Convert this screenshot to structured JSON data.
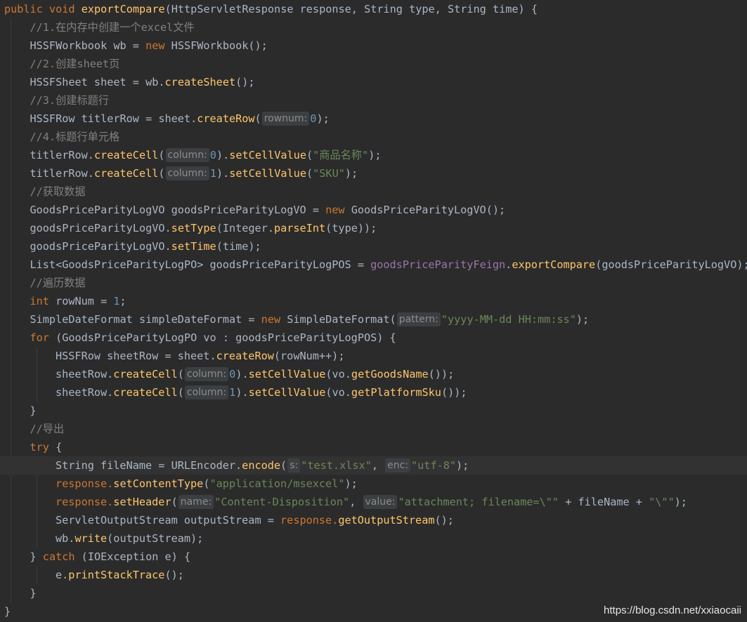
{
  "editor": {
    "theme": {
      "background": "#2b2b2b",
      "current_line": "#323232",
      "default_text": "#a9b7c6",
      "keyword": "#cc7832",
      "method": "#ffc66d",
      "type": "#a9b7c6",
      "comment": "#808080",
      "string": "#6a8759",
      "number": "#6897bb",
      "field": "#9876aa",
      "hint_bg": "#3b3f41",
      "hint_text": "#8c8c8c"
    },
    "lines": [
      {
        "indent": 0,
        "tokens": [
          {
            "t": "public void ",
            "c": "kw"
          },
          {
            "t": "exportCompare",
            "c": "meth"
          },
          {
            "t": "(HttpServletResponse ",
            "c": "def"
          },
          {
            "t": "response",
            "c": "def"
          },
          {
            "t": ", String ",
            "c": "def"
          },
          {
            "t": "type",
            "c": "def"
          },
          {
            "t": ", String ",
            "c": "def"
          },
          {
            "t": "time",
            "c": "def"
          },
          {
            "t": ") {",
            "c": "def"
          }
        ]
      },
      {
        "indent": 1,
        "tokens": [
          {
            "t": "//1.在内存中创建一个excel文件",
            "c": "cmt"
          }
        ]
      },
      {
        "indent": 1,
        "tokens": [
          {
            "t": "HSSFWorkbook wb = ",
            "c": "def"
          },
          {
            "t": "new ",
            "c": "kw"
          },
          {
            "t": "HSSFWorkbook();",
            "c": "def"
          }
        ]
      },
      {
        "indent": 1,
        "tokens": [
          {
            "t": "//2.创建sheet页",
            "c": "cmt"
          }
        ]
      },
      {
        "indent": 1,
        "tokens": [
          {
            "t": "HSSFSheet sheet = wb.",
            "c": "def"
          },
          {
            "t": "createSheet",
            "c": "meth"
          },
          {
            "t": "();",
            "c": "def"
          }
        ]
      },
      {
        "indent": 1,
        "tokens": [
          {
            "t": "//3.创建标题行",
            "c": "cmt"
          }
        ]
      },
      {
        "indent": 1,
        "tokens": [
          {
            "t": "HSSFRow titlerRow = sheet.",
            "c": "def"
          },
          {
            "t": "createRow",
            "c": "meth"
          },
          {
            "t": "(",
            "c": "def"
          },
          {
            "h": "rownum:"
          },
          {
            "t": "0",
            "c": "num"
          },
          {
            "t": ");",
            "c": "def"
          }
        ]
      },
      {
        "indent": 1,
        "tokens": [
          {
            "t": "//4.标题行单元格",
            "c": "cmt"
          }
        ]
      },
      {
        "indent": 1,
        "tokens": [
          {
            "t": "titlerRow.",
            "c": "def"
          },
          {
            "t": "createCell",
            "c": "meth"
          },
          {
            "t": "(",
            "c": "def"
          },
          {
            "h": "column:"
          },
          {
            "t": "0",
            "c": "num"
          },
          {
            "t": ").",
            "c": "def"
          },
          {
            "t": "setCellValue",
            "c": "meth"
          },
          {
            "t": "(",
            "c": "def"
          },
          {
            "t": "\"商品名称\"",
            "c": "str"
          },
          {
            "t": ");",
            "c": "def"
          }
        ]
      },
      {
        "indent": 1,
        "tokens": [
          {
            "t": "titlerRow.",
            "c": "def"
          },
          {
            "t": "createCell",
            "c": "meth"
          },
          {
            "t": "(",
            "c": "def"
          },
          {
            "h": "column:"
          },
          {
            "t": "1",
            "c": "num"
          },
          {
            "t": ").",
            "c": "def"
          },
          {
            "t": "setCellValue",
            "c": "meth"
          },
          {
            "t": "(",
            "c": "def"
          },
          {
            "t": "\"SKU\"",
            "c": "str"
          },
          {
            "t": ");",
            "c": "def"
          }
        ]
      },
      {
        "indent": 1,
        "tokens": [
          {
            "t": "//获取数据",
            "c": "cmt"
          }
        ]
      },
      {
        "indent": 1,
        "tokens": [
          {
            "t": "GoodsPriceParityLogVO goodsPriceParityLogVO = ",
            "c": "def"
          },
          {
            "t": "new ",
            "c": "kw"
          },
          {
            "t": "GoodsPriceParityLogVO();",
            "c": "def"
          }
        ]
      },
      {
        "indent": 1,
        "tokens": [
          {
            "t": "goodsPriceParityLogVO.",
            "c": "def"
          },
          {
            "t": "setType",
            "c": "meth"
          },
          {
            "t": "(Integer.",
            "c": "def"
          },
          {
            "t": "parseInt",
            "c": "meth"
          },
          {
            "t": "(type));",
            "c": "def"
          }
        ]
      },
      {
        "indent": 1,
        "tokens": [
          {
            "t": "goodsPriceParityLogVO.",
            "c": "def"
          },
          {
            "t": "setTime",
            "c": "meth"
          },
          {
            "t": "(time);",
            "c": "def"
          }
        ]
      },
      {
        "indent": 1,
        "tokens": [
          {
            "t": "List<GoodsPriceParityLogPO> goodsPriceParityLogPOS = ",
            "c": "def"
          },
          {
            "t": "goodsPriceParityFeign",
            "c": "fld"
          },
          {
            "t": ".",
            "c": "def"
          },
          {
            "t": "exportCompare",
            "c": "meth"
          },
          {
            "t": "(goodsPriceParityLogVO);",
            "c": "def"
          }
        ]
      },
      {
        "indent": 1,
        "tokens": [
          {
            "t": "//遍历数据",
            "c": "cmt"
          }
        ]
      },
      {
        "indent": 1,
        "tokens": [
          {
            "t": "int ",
            "c": "kw"
          },
          {
            "t": "rowNum = ",
            "c": "def"
          },
          {
            "t": "1",
            "c": "num"
          },
          {
            "t": ";",
            "c": "def"
          }
        ]
      },
      {
        "indent": 1,
        "tokens": [
          {
            "t": "SimpleDateFormat simpleDateFormat = ",
            "c": "def"
          },
          {
            "t": "new ",
            "c": "kw"
          },
          {
            "t": "SimpleDateFormat(",
            "c": "def"
          },
          {
            "h": "pattern:"
          },
          {
            "t": "\"yyyy-MM-dd HH:mm:ss\"",
            "c": "str"
          },
          {
            "t": ");",
            "c": "def"
          }
        ]
      },
      {
        "indent": 1,
        "tokens": [
          {
            "t": "for ",
            "c": "kw"
          },
          {
            "t": "(GoodsPriceParityLogPO vo : goodsPriceParityLogPOS) {",
            "c": "def"
          }
        ]
      },
      {
        "indent": 2,
        "tokens": [
          {
            "t": "HSSFRow sheetRow = sheet.",
            "c": "def"
          },
          {
            "t": "createRow",
            "c": "meth"
          },
          {
            "t": "(rowNum++);",
            "c": "def"
          }
        ]
      },
      {
        "indent": 2,
        "tokens": [
          {
            "t": "sheetRow.",
            "c": "def"
          },
          {
            "t": "createCell",
            "c": "meth"
          },
          {
            "t": "(",
            "c": "def"
          },
          {
            "h": "column:"
          },
          {
            "t": "0",
            "c": "num"
          },
          {
            "t": ").",
            "c": "def"
          },
          {
            "t": "setCellValue",
            "c": "meth"
          },
          {
            "t": "(vo.",
            "c": "def"
          },
          {
            "t": "getGoodsName",
            "c": "meth"
          },
          {
            "t": "());",
            "c": "def"
          }
        ]
      },
      {
        "indent": 2,
        "tokens": [
          {
            "t": "sheetRow.",
            "c": "def"
          },
          {
            "t": "createCell",
            "c": "meth"
          },
          {
            "t": "(",
            "c": "def"
          },
          {
            "h": "column:"
          },
          {
            "t": "1",
            "c": "num"
          },
          {
            "t": ").",
            "c": "def"
          },
          {
            "t": "setCellValue",
            "c": "meth"
          },
          {
            "t": "(vo.",
            "c": "def"
          },
          {
            "t": "getPlatformSku",
            "c": "meth"
          },
          {
            "t": "());",
            "c": "def"
          }
        ]
      },
      {
        "indent": 1,
        "tokens": [
          {
            "t": "}",
            "c": "def"
          }
        ]
      },
      {
        "indent": 1,
        "tokens": [
          {
            "t": "//导出",
            "c": "cmt"
          }
        ]
      },
      {
        "indent": 1,
        "tokens": [
          {
            "t": "try ",
            "c": "kw"
          },
          {
            "t": "{",
            "c": "def"
          }
        ]
      },
      {
        "indent": 2,
        "current": true,
        "tokens": [
          {
            "t": "String fileName = URLEncoder.",
            "c": "def"
          },
          {
            "t": "encode",
            "c": "meth"
          },
          {
            "t": "(",
            "c": "def"
          },
          {
            "h": "s:"
          },
          {
            "t": "\"test.xlsx\"",
            "c": "str"
          },
          {
            "t": ", ",
            "c": "def"
          },
          {
            "h": "enc:"
          },
          {
            "t": "\"utf-8\"",
            "c": "str"
          },
          {
            "t": ");",
            "c": "def"
          }
        ]
      },
      {
        "indent": 2,
        "tokens": [
          {
            "t": "response.",
            "c": "kw"
          },
          {
            "t": "setContentType",
            "c": "meth"
          },
          {
            "t": "(",
            "c": "def"
          },
          {
            "t": "\"application/msexcel\"",
            "c": "str"
          },
          {
            "t": ");",
            "c": "def"
          }
        ]
      },
      {
        "indent": 2,
        "tokens": [
          {
            "t": "response.",
            "c": "kw"
          },
          {
            "t": "setHeader",
            "c": "meth"
          },
          {
            "t": "(",
            "c": "def"
          },
          {
            "h": "name:"
          },
          {
            "t": "\"Content-Disposition\"",
            "c": "str"
          },
          {
            "t": ", ",
            "c": "def"
          },
          {
            "h": "value:"
          },
          {
            "t": "\"attachment; filename=\\\"\"",
            "c": "str"
          },
          {
            "t": " + fileName + ",
            "c": "def"
          },
          {
            "t": "\"\\\"\"",
            "c": "str"
          },
          {
            "t": ");",
            "c": "def"
          }
        ]
      },
      {
        "indent": 2,
        "tokens": [
          {
            "t": "ServletOutputStream outputStream = ",
            "c": "def"
          },
          {
            "t": "response.",
            "c": "kw"
          },
          {
            "t": "getOutputStream",
            "c": "meth"
          },
          {
            "t": "();",
            "c": "def"
          }
        ]
      },
      {
        "indent": 2,
        "tokens": [
          {
            "t": "wb.",
            "c": "def"
          },
          {
            "t": "write",
            "c": "meth"
          },
          {
            "t": "(outputStream);",
            "c": "def"
          }
        ]
      },
      {
        "indent": 1,
        "tokens": [
          {
            "t": "} ",
            "c": "def"
          },
          {
            "t": "catch ",
            "c": "kw"
          },
          {
            "t": "(IOException e) {",
            "c": "def"
          }
        ]
      },
      {
        "indent": 2,
        "tokens": [
          {
            "t": "e.",
            "c": "def"
          },
          {
            "t": "printStackTrace",
            "c": "meth"
          },
          {
            "t": "();",
            "c": "def"
          }
        ]
      },
      {
        "indent": 1,
        "tokens": [
          {
            "t": "}",
            "c": "def"
          }
        ]
      },
      {
        "indent": 0,
        "tokens": [
          {
            "t": "}",
            "c": "def"
          }
        ]
      }
    ]
  },
  "watermark": "https://blog.csdn.net/xxiaocaii"
}
